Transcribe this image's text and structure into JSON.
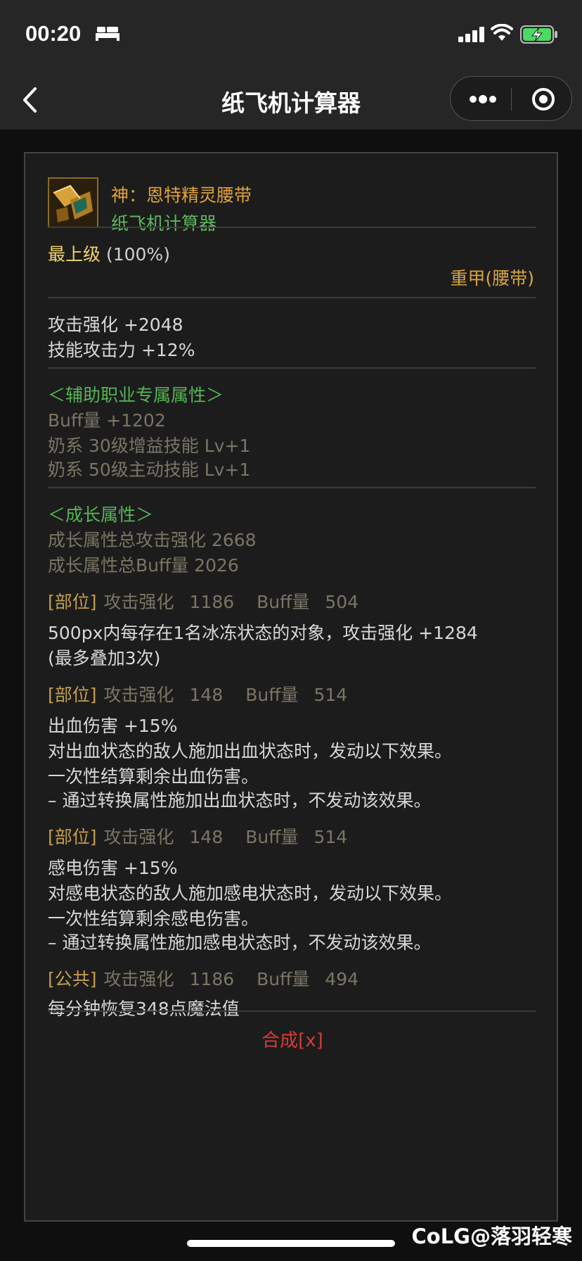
{
  "status_bar": {
    "time": "00:20",
    "icons": [
      "bed-icon",
      "signal-icon",
      "wifi-icon",
      "battery-charging-icon"
    ]
  },
  "nav": {
    "title": "纸飞机计算器",
    "icons": [
      "back-icon",
      "more-icon",
      "target-icon"
    ]
  },
  "item": {
    "name": "神：恩特精灵腰带",
    "source": "纸飞机计算器",
    "grade_label": "最上级",
    "grade_pct": " (100%)",
    "type": "重甲(腰带)"
  },
  "stats": {
    "line1": "攻击强化 +2048",
    "line2": "技能攻击力 +12%"
  },
  "support": {
    "header": "＜辅助职业专属属性＞",
    "line1": "Buff量 +1202",
    "line2": "奶系 30级增益技能 Lv+1",
    "line3": "奶系 50级主动技能 Lv+1"
  },
  "growth": {
    "header": "＜成长属性＞",
    "total_attack": "成长属性总攻击强化 2668",
    "total_buff": "成长属性总Buff量 2026"
  },
  "parts": [
    {
      "tag": "[部位]",
      "atk_label": "攻击强化",
      "atk": "1186",
      "buff_label": "Buff量",
      "buff": "504",
      "desc": [
        "500px内每存在1名冰冻状态的对象，攻击强化 +1284",
        "(最多叠加3次)"
      ]
    },
    {
      "tag": "[部位]",
      "atk_label": "攻击强化",
      "atk": "148",
      "buff_label": "Buff量",
      "buff": "514",
      "desc": [
        "出血伤害 +15%",
        "对出血状态的敌人施加出血状态时，发动以下效果。",
        "一次性结算剩余出血伤害。",
        "– 通过转换属性施加出血状态时，不发动该效果。"
      ]
    },
    {
      "tag": "[部位]",
      "atk_label": "攻击强化",
      "atk": "148",
      "buff_label": "Buff量",
      "buff": "514",
      "desc": [
        "感电伤害 +15%",
        "对感电状态的敌人施加感电状态时，发动以下效果。",
        "一次性结算剩余感电伤害。",
        "– 通过转换属性施加感电状态时，不发动该效果。"
      ]
    },
    {
      "tag": "[公共]",
      "atk_label": "攻击强化",
      "atk": "1186",
      "buff_label": "Buff量",
      "buff": "494",
      "desc": [
        "每分钟恢复348点魔法值"
      ]
    }
  ],
  "synth_label": "合成[x]",
  "watermark": "CoLG@落羽轻寒",
  "colors": {
    "status_bg": "#262626",
    "card_bg": "#1c1c1c",
    "legendary_orange": "#e0a23a",
    "green": "#56b456",
    "grade_gold": "#f2d46a",
    "muted": "#7b7565",
    "red": "#d93a3a"
  }
}
